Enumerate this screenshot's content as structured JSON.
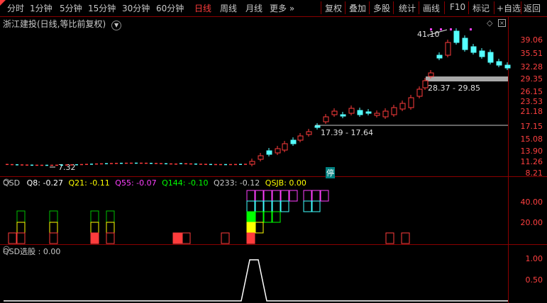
{
  "toolbar": {
    "left": [
      "分时",
      "1分钟",
      "5分钟",
      "15分钟",
      "30分钟",
      "60分钟",
      "日线",
      "周线",
      "月线",
      "更多 »"
    ],
    "right": [
      "复权",
      "叠加",
      "多股",
      "统计",
      "画线",
      "F10",
      "标记",
      "+自选",
      "返回"
    ],
    "active": "日线"
  },
  "main": {
    "title": "浙江建投(日线,等比前复权)",
    "title_icon": "chevron-down-icon",
    "right_icons": [
      "diamond-icon",
      "close-box-icon"
    ],
    "y_labels": [
      "39.06",
      "35.51",
      "32.28",
      "29.35",
      "26.15",
      "23.53",
      "21.18",
      "17.15",
      "15.08",
      "13.90",
      "11.26",
      "8.21"
    ],
    "annotations": {
      "high": "41.10",
      "low": "7.32",
      "range_high": "28.37 - 29.85",
      "range_mid": "17.39 - 17.64",
      "halt_badge": "停"
    }
  },
  "qsd": {
    "label": "QSD",
    "items": [
      {
        "name": "Q8",
        "value": "-0.27",
        "color": "#ffffff"
      },
      {
        "name": "Q21",
        "value": "-0.11",
        "color": "#ffff00"
      },
      {
        "name": "Q55",
        "value": "-0.07",
        "color": "#ff40ff"
      },
      {
        "name": "Q144",
        "value": "-0.10",
        "color": "#00ff00"
      },
      {
        "name": "Q233",
        "value": "-0.12",
        "color": "#c8c8c8"
      },
      {
        "name": "QSJB",
        "value": "0.00",
        "color": "#ffff00"
      }
    ],
    "y_labels": [
      "40.00",
      "20.00"
    ]
  },
  "select": {
    "label": "QSD选股",
    "value": "0.00",
    "y_labels": [
      "1.00",
      "0.50"
    ]
  },
  "colors": {
    "up": "#ff3c3c",
    "down": "#54ffff",
    "frame": "#8b0000",
    "axis_text": "#ff4040"
  }
}
